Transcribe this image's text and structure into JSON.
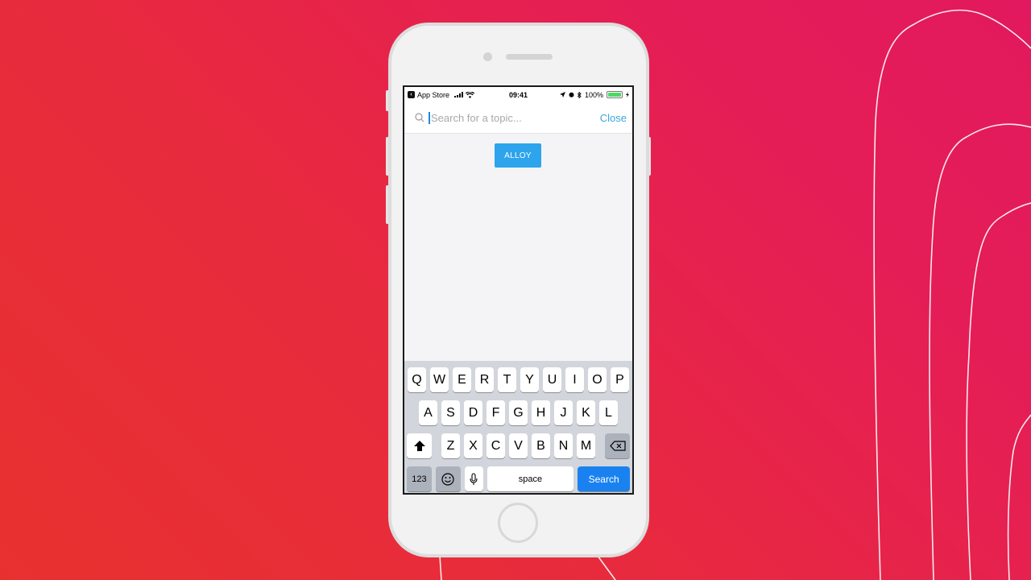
{
  "background": {
    "gradient_colors": [
      "#e8312f",
      "#e2195e"
    ],
    "decor_line_color": "#ffffff"
  },
  "statusbar": {
    "back_app": "App Store",
    "time": "09:41",
    "battery": "100%",
    "battery_level": 1.0
  },
  "search": {
    "placeholder": "Search for a topic...",
    "value": "",
    "close_label": "Close"
  },
  "tags": [
    {
      "label": "ALLOY",
      "color": "#2da4ec"
    }
  ],
  "keyboard": {
    "row1": [
      "Q",
      "W",
      "E",
      "R",
      "T",
      "Y",
      "U",
      "I",
      "O",
      "P"
    ],
    "row2": [
      "A",
      "S",
      "D",
      "F",
      "G",
      "H",
      "J",
      "K",
      "L"
    ],
    "row3": [
      "Z",
      "X",
      "C",
      "V",
      "B",
      "N",
      "M"
    ],
    "numbers_label": "123",
    "space_label": "space",
    "return_label": "Search",
    "return_color": "#1a82f0"
  }
}
